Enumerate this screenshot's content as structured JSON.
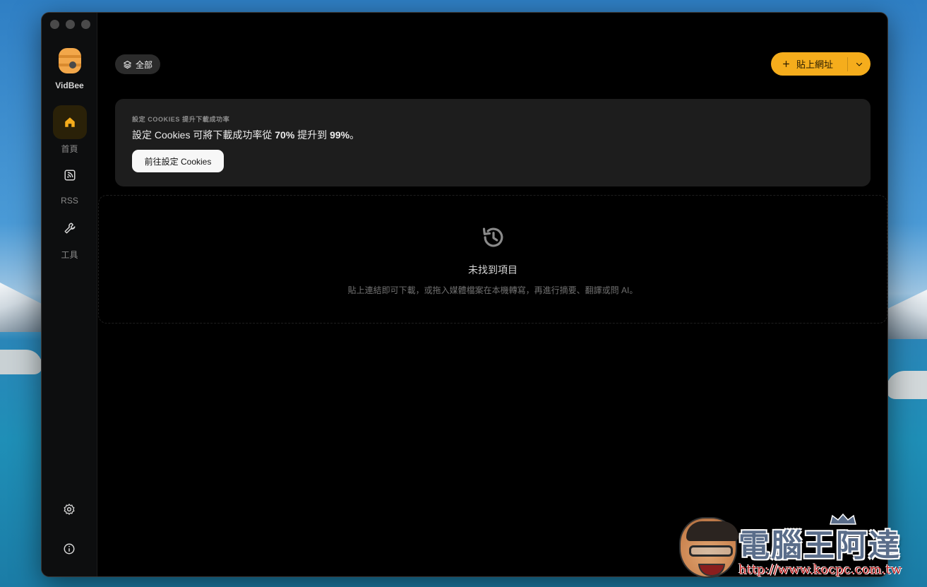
{
  "app": {
    "name": "VidBee"
  },
  "sidebar": {
    "items": [
      {
        "label": "首頁",
        "icon": "home-icon",
        "active": true
      },
      {
        "label": "RSS",
        "icon": "rss-icon",
        "active": false
      },
      {
        "label": "工具",
        "icon": "wrench-icon",
        "active": false
      }
    ],
    "bottom": [
      {
        "icon": "settings-icon"
      },
      {
        "icon": "info-icon"
      }
    ]
  },
  "toolbar": {
    "filter_label": "全部",
    "paste_label": "貼上網址"
  },
  "cookie_banner": {
    "kicker": "設定 COOKIES 提升下載成功率",
    "desc_prefix": "設定 Cookies 可將下載成功率從 ",
    "from_rate": "70%",
    "desc_middle": " 提升到 ",
    "to_rate": "99%",
    "desc_suffix": "。",
    "button_label": "前往設定 Cookies"
  },
  "empty_state": {
    "title": "未找到項目",
    "subtitle": "貼上連結即可下載，或拖入媒體檔案在本機轉寫，再進行摘要、翻譯或問 AI。"
  },
  "watermark": {
    "title": "電腦王阿達",
    "url": "http://www.kocpc.com.tw"
  },
  "colors": {
    "accent": "#f5ad1c",
    "window_bg": "#000000",
    "sidebar_bg": "#0d0e0f",
    "card_bg": "#1d1d1d"
  }
}
